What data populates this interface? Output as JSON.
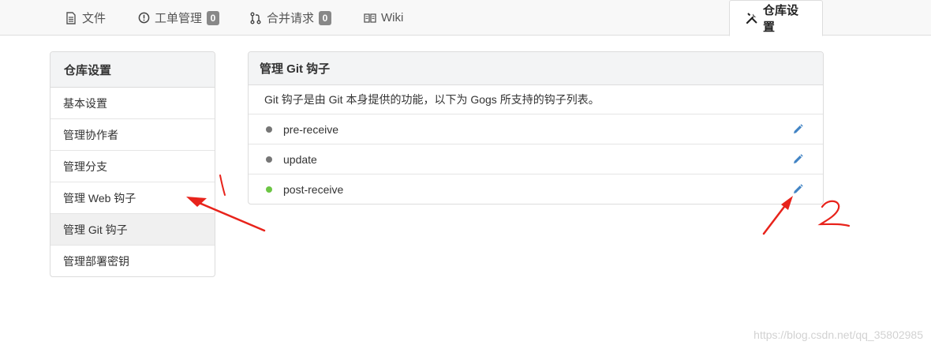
{
  "tabs": [
    {
      "label": "文件",
      "icon": "file-icon"
    },
    {
      "label": "工单管理",
      "icon": "issue-icon",
      "badge": "0"
    },
    {
      "label": "合并请求",
      "icon": "pull-request-icon",
      "badge": "0"
    },
    {
      "label": "Wiki",
      "icon": "book-icon"
    },
    {
      "label": "仓库设置",
      "icon": "tools-icon",
      "active": true
    }
  ],
  "sidebar": {
    "title": "仓库设置",
    "items": [
      {
        "label": "基本设置"
      },
      {
        "label": "管理协作者"
      },
      {
        "label": "管理分支"
      },
      {
        "label": "管理 Web 钩子"
      },
      {
        "label": "管理 Git 钩子",
        "active": true
      },
      {
        "label": "管理部署密钥"
      }
    ]
  },
  "panel": {
    "title": "管理 Git 钩子",
    "description": "Git 钩子是由 Git 本身提供的功能，以下为 Gogs 所支持的钩子列表。",
    "hooks": [
      {
        "name": "pre-receive",
        "status_color": "#767676"
      },
      {
        "name": "update",
        "status_color": "#767676"
      },
      {
        "name": "post-receive",
        "status_color": "#6cc644"
      }
    ]
  },
  "colors": {
    "edit_icon": "#4183c4",
    "annotation": "#e8231b"
  },
  "watermark": "https://blog.csdn.net/qq_35802985"
}
